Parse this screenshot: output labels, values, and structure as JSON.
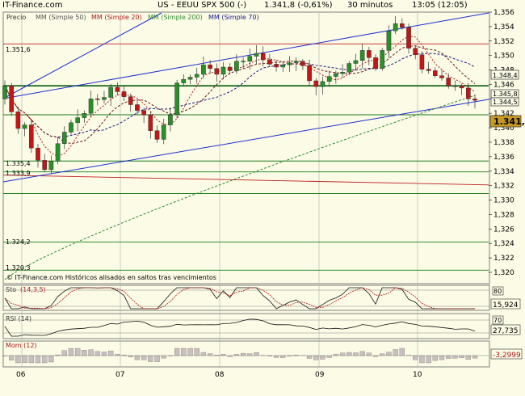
{
  "header": {
    "source": "IT-Finance.com",
    "instrument": "US - EEUU SPX 500 (-)",
    "price_change": "1.341,8 (-0,61%)",
    "timeframe": "30 minutos",
    "time": "13:05 (12:05)"
  },
  "main_legend": {
    "price": "Precio",
    "ma50": "MM (Simple 50)",
    "ma20": "MM (Simple 20)",
    "ma200": "MM (Simple 200)",
    "ma70": "MM (Simple 70)"
  },
  "footer_note": "© IT-Finance.com  Históricos alisados en saltos tras vencimientos",
  "colors": {
    "background": "#fbfbe6",
    "plot_bg": "#fbfbe6",
    "up": "#2a8f2a",
    "down": "#c01818",
    "ma20": "#b01818",
    "ma50": "#6b1b1b",
    "ma200": "#2f8a2f",
    "ma70": "#1a1a8a",
    "channel": "#1f2fd0",
    "support": "#1a7a1a",
    "resistance": "#c02020",
    "last_price_bg": "#c89a20"
  },
  "last_price_label": "1.341,8",
  "right_price_labels": [
    "1.348,4",
    "1.345,8",
    "1.344,5"
  ],
  "level_labels": [
    "1.351,6",
    "1.335,4",
    "1.333,9",
    "1.324,2",
    "1.320,3"
  ],
  "price_ticks": [
    "1,356",
    "1,354",
    "1,352",
    "1,350",
    "1,348",
    "1,346",
    "1,344",
    "1,342",
    "1,340",
    "1,338",
    "1,336",
    "1,334",
    "1,332",
    "1,330",
    "1,328",
    "1,326",
    "1,324",
    "1,322",
    "1,320"
  ],
  "x_ticks": [
    "06",
    "07",
    "08",
    "09",
    "10"
  ],
  "stoch": {
    "label": "Sto",
    "params": "(14,3,5)",
    "level_label": "80",
    "value": "15,924"
  },
  "rsi": {
    "label": "RSI (14)",
    "level_label": "70",
    "value": "27,735"
  },
  "mom": {
    "label": "Mom (12)",
    "value": "-3,2999"
  },
  "chart_data": {
    "type": "candlestick",
    "title": "US - EEUU SPX 500 (-)",
    "timeframe": "30 minutos",
    "x": [
      "06",
      "07",
      "08",
      "09",
      "10"
    ],
    "ylim": [
      1319,
      1358
    ],
    "close": [
      1345.8,
      1342.2,
      1339.9,
      1340.4,
      1337.2,
      1335.5,
      1334.2,
      1335.4,
      1337.8,
      1339.4,
      1340.7,
      1341.4,
      1342.0,
      1344.0,
      1343.9,
      1344.2,
      1345.6,
      1345.0,
      1344.3,
      1343.2,
      1342.4,
      1341.8,
      1339.6,
      1338.4,
      1340.4,
      1341.8,
      1346.2,
      1346.7,
      1347.0,
      1347.4,
      1348.7,
      1348.2,
      1347.4,
      1348.4,
      1347.9,
      1349.2,
      1349.2,
      1349.9,
      1350.3,
      1349.4,
      1348.8,
      1348.4,
      1348.7,
      1349.0,
      1349.2,
      1348.6,
      1346.5,
      1345.7,
      1346.4,
      1347.1,
      1347.5,
      1347.7,
      1348.9,
      1349.3,
      1350.7,
      1349.7,
      1348.2,
      1350.7,
      1353.4,
      1354.4,
      1353.9,
      1351.0,
      1350.1,
      1348.1,
      1347.9,
      1347.2,
      1346.9,
      1345.8,
      1345.8,
      1345.5,
      1344.0,
      1343.8
    ],
    "ma20_last": 1345.8,
    "ma200_last": 1344.5,
    "levels": [
      1351.6,
      1345.8,
      1341.8,
      1335.4,
      1333.9,
      1332.5,
      1330.9,
      1324.2,
      1320.3
    ],
    "indicators": {
      "stochastic": {
        "params": [
          14,
          3,
          5
        ],
        "levels": [
          80,
          20
        ],
        "last": 15.924
      },
      "rsi": {
        "period": 14,
        "levels": [
          70,
          30
        ],
        "last": 27.735
      },
      "momentum": {
        "period": 12,
        "last": -3.2999
      }
    }
  }
}
